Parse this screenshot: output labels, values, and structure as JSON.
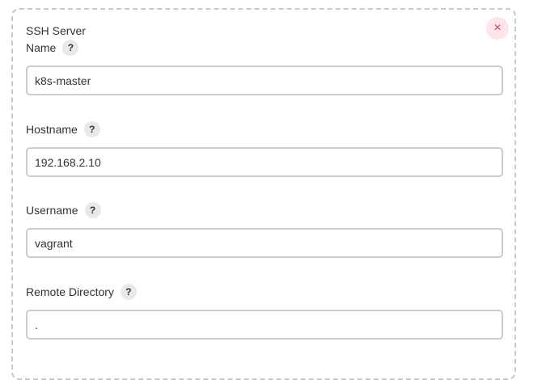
{
  "section": {
    "title": "SSH Server",
    "close_label": "×"
  },
  "help_label": "?",
  "fields": [
    {
      "label": "Name",
      "value": "k8s-master"
    },
    {
      "label": "Hostname",
      "value": "192.168.2.10"
    },
    {
      "label": "Username",
      "value": "vagrant"
    },
    {
      "label": "Remote Directory",
      "value": "."
    }
  ],
  "colors": {
    "border_dashed": "#c9c9c9",
    "input_border": "#c7cdd1",
    "close_bg": "#fde6ea",
    "close_fg": "#e0364c",
    "help_bg": "#e9e9e9"
  }
}
